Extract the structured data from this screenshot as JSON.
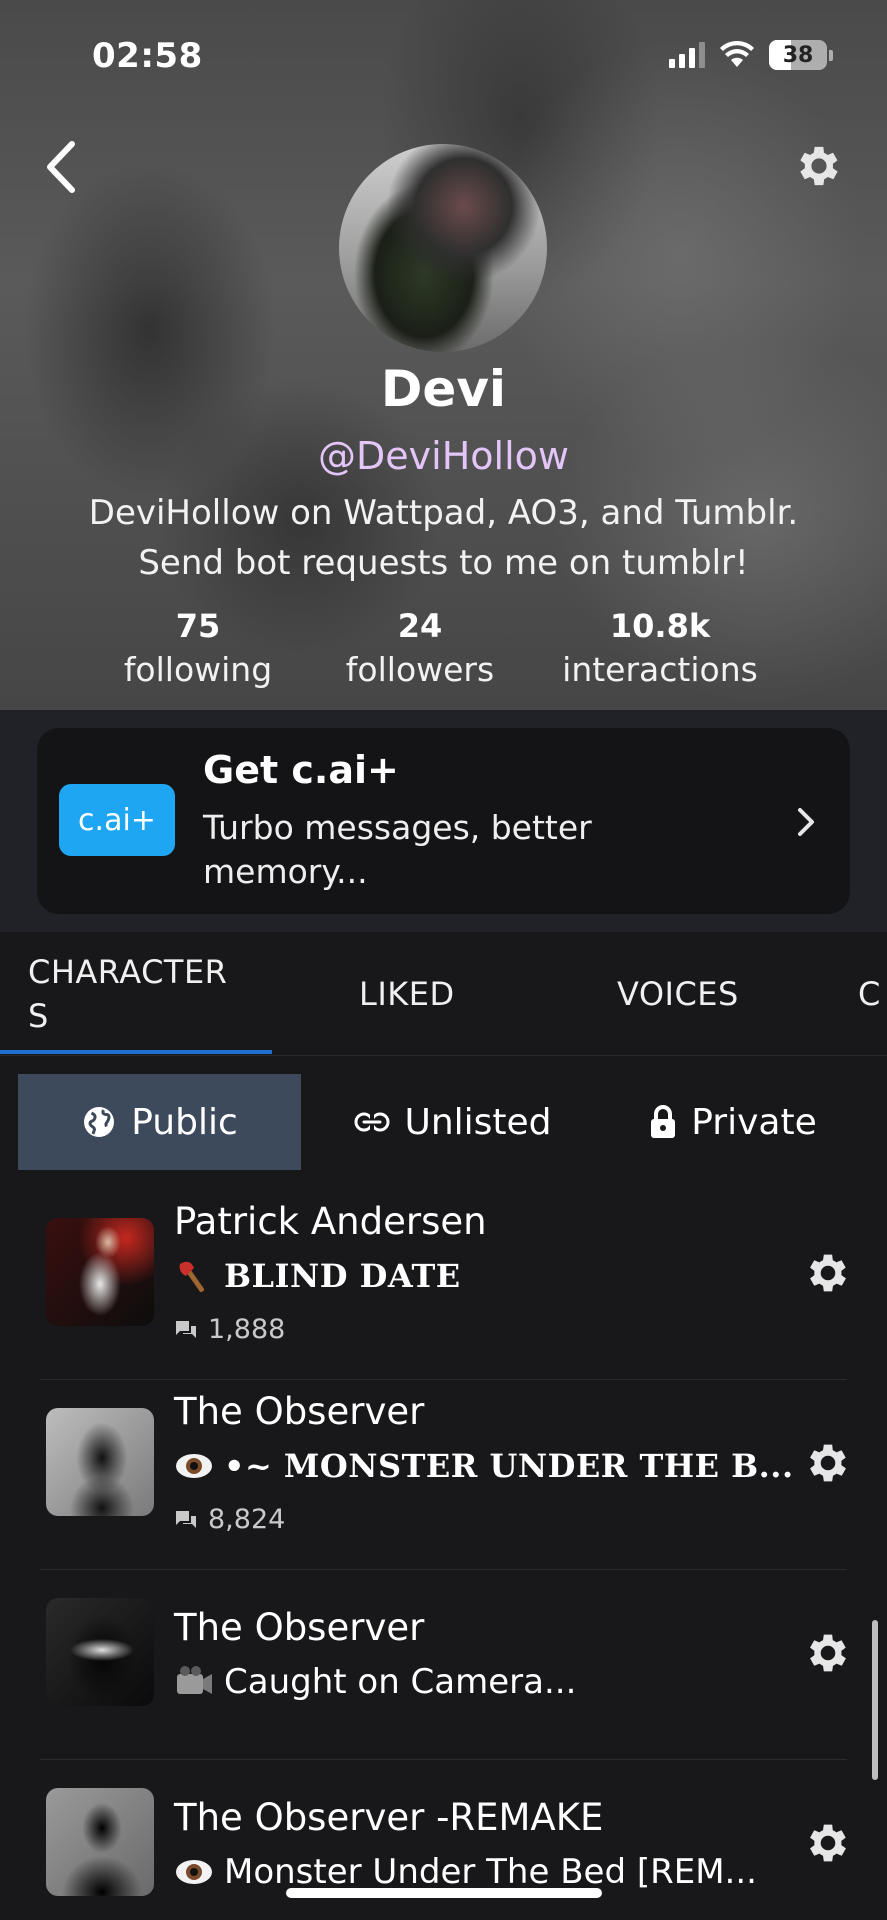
{
  "status_bar": {
    "time": "02:58",
    "battery": "38"
  },
  "profile": {
    "display_name": "Devi",
    "username": "@DeviHollow",
    "bio_line1": "DeviHollow on Wattpad, AO3, and Tumblr.",
    "bio_line2": "Send bot requests to me on tumblr!",
    "stats": [
      {
        "value": "75",
        "label": "following"
      },
      {
        "value": "24",
        "label": "followers"
      },
      {
        "value": "10.8k",
        "label": "interactions"
      }
    ]
  },
  "promo": {
    "badge": "c.ai+",
    "title": "Get c.ai+",
    "subtitle": "Turbo messages, better memory..."
  },
  "tabs": [
    {
      "label": "CHARACTER S"
    },
    {
      "label": "LIKED"
    },
    {
      "label": "VOICES"
    },
    {
      "label": "C"
    }
  ],
  "filters": [
    {
      "label": "Public",
      "icon": "globe-icon",
      "active": true
    },
    {
      "label": "Unlisted",
      "icon": "link-icon",
      "active": false
    },
    {
      "label": "Private",
      "icon": "lock-icon",
      "active": false
    }
  ],
  "characters": [
    {
      "name": "Patrick Andersen",
      "tagline": "𝐁𝐋𝐈𝐍𝐃 𝐃𝐀𝐓𝐄",
      "tag_text": "BLIND DATE",
      "tag_icon": "axe-emoji",
      "count": "1,888"
    },
    {
      "name": "The Observer",
      "tag_text": "•~ MONSTER UNDER THE B...",
      "tag_icon": "eye-emoji",
      "count": "8,824"
    },
    {
      "name": "The Observer",
      "tag_text": "Caught on Camera...",
      "tag_icon": "camera-emoji",
      "count": ""
    },
    {
      "name": "The Observer -REMAKE",
      "tag_text": "Monster Under The Bed [REM...",
      "tag_icon": "eye-emoji",
      "count": ""
    }
  ],
  "colors": {
    "accent": "#1fa6f3",
    "tab_underline": "#1f6fd1",
    "username": "#e3c5f7",
    "active_filter": "#3d4a5c"
  }
}
